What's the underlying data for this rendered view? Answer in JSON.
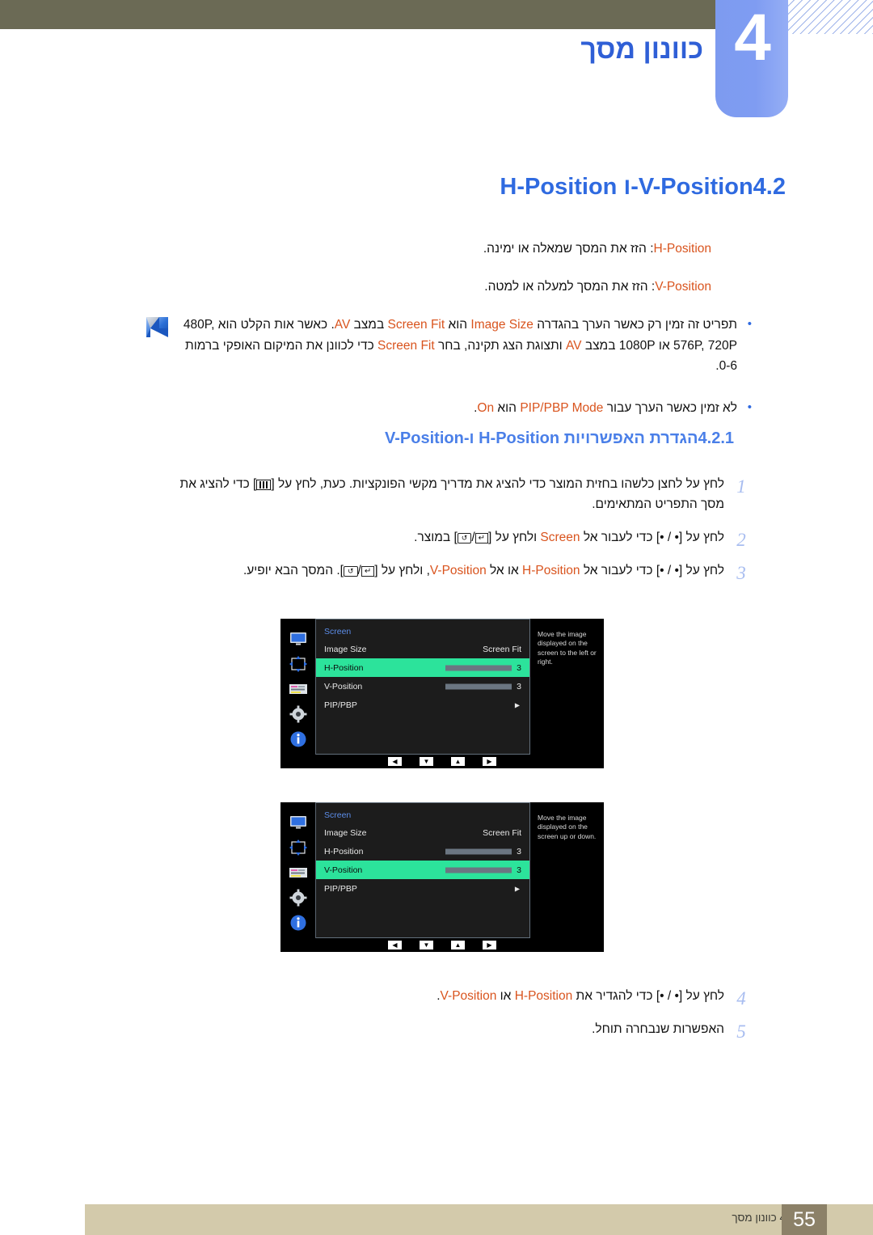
{
  "header": {
    "chapter_number": "4",
    "chapter_title": "כוונון מסך"
  },
  "section": {
    "number": "4.2",
    "title": "H-Position ו-V-Position"
  },
  "descriptions": {
    "h_position_label": "H-Position",
    "h_position_text": ": הזז את המסך שמאלה או ימינה.",
    "v_position_label": "V-Position",
    "v_position_text": ": הזז את המסך למעלה או למטה."
  },
  "notes": {
    "icon": "note-page-icon",
    "bullet1": {
      "part_a": "תפריט זה זמין רק כאשר הערך בהגדרה ",
      "image_size": "Image Size",
      "part_b": " הוא ",
      "screen_fit_1": "Screen Fit",
      "part_c": " במצב ",
      "av_1": "AV",
      "part_d": ". כאשר אות הקלט הוא ",
      "res_1": "480P, 576P, 720P",
      "part_e": " או ",
      "res_2": "1080P",
      "part_f": " במצב ",
      "av_2": "AV",
      "part_g": " ותצוגת הצג תקינה, בחר ",
      "screen_fit_2": "Screen Fit",
      "part_h": " כדי לכוונן את המיקום האופקי ברמות 0-6."
    },
    "bullet2": {
      "part_a": "לא זמין כאשר הערך עבור ",
      "pip_pbp_mode": "PIP/PBP Mode",
      "part_b": " הוא ",
      "on": "On",
      "part_c": "."
    }
  },
  "subsection": {
    "number": "4.2.1",
    "title": "הגדרת האפשרויות H-Position ו-V-Position"
  },
  "steps": [
    {
      "num": "1",
      "text_a": "לחץ על לחצן כלשהו בחזית המוצר כדי להציג את מדריך מקשי הפונקציות. כעת, לחץ על [",
      "glyph": "menu-bars-icon",
      "text_b": "] כדי להציג את מסך התפריט המתאימים."
    },
    {
      "num": "2",
      "text_a": "לחץ על [",
      "dot1": "•",
      "sep": " / ",
      "dot2": "•",
      "text_b": "] כדי לעבור אל ",
      "screen": "Screen",
      "text_c": " ולחץ על [",
      "glyph2": "return-loop-icon",
      "text_d": "] במוצר."
    },
    {
      "num": "3",
      "text_a": "לחץ על [",
      "text_b": "] כדי לעבור אל ",
      "h_position": "H-Position",
      "text_c": " או אל ",
      "v_position": "V-Position",
      "text_d": ", ולחץ על [",
      "text_e": "]. המסך הבא יופיע."
    },
    {
      "num": "4",
      "text_a": "לחץ על [",
      "text_b": "] כדי להגדיר את ",
      "h_position": "H-Position",
      "text_c": " או ",
      "v_position": "V-Position",
      "text_d": "."
    },
    {
      "num": "5",
      "text_a": "האפשרות שנבחרה תוחל."
    }
  ],
  "osd": {
    "rail_icons": [
      "monitor-icon",
      "position-arrows-icon",
      "picture-settings-icon",
      "gear-icon",
      "info-icon"
    ],
    "footer_keys": [
      "◀",
      "▼",
      "▲",
      "▶"
    ],
    "menu1": {
      "heading": "Screen",
      "rows": [
        {
          "label": "Image Size",
          "value": "Screen Fit",
          "type": "text",
          "selected": false
        },
        {
          "label": "H-Position",
          "value": "3",
          "type": "slider",
          "selected": true
        },
        {
          "label": "V-Position",
          "value": "3",
          "type": "slider",
          "selected": false
        },
        {
          "label": "PIP/PBP",
          "value": "▶",
          "type": "arrow",
          "selected": false
        }
      ],
      "help": "Move the image displayed on the screen to the left or right."
    },
    "menu2": {
      "heading": "Screen",
      "rows": [
        {
          "label": "Image Size",
          "value": "Screen Fit",
          "type": "text",
          "selected": false
        },
        {
          "label": "H-Position",
          "value": "3",
          "type": "slider",
          "selected": false
        },
        {
          "label": "V-Position",
          "value": "3",
          "type": "slider",
          "selected": true
        },
        {
          "label": "PIP/PBP",
          "value": "▶",
          "type": "arrow",
          "selected": false
        }
      ],
      "help": "Move the image displayed on the screen up or down."
    }
  },
  "footer": {
    "page_number": "55",
    "text": "4 כוונון מסך"
  },
  "colors": {
    "header_olive": "#6b6a55",
    "chapter_blue": "#7f9cf2",
    "title_blue": "#2f6ae0",
    "orange": "#d9541e",
    "osd_highlight": "#2ce39b",
    "footer_tan": "#d3caab",
    "footer_page_bg": "#8c8168"
  }
}
